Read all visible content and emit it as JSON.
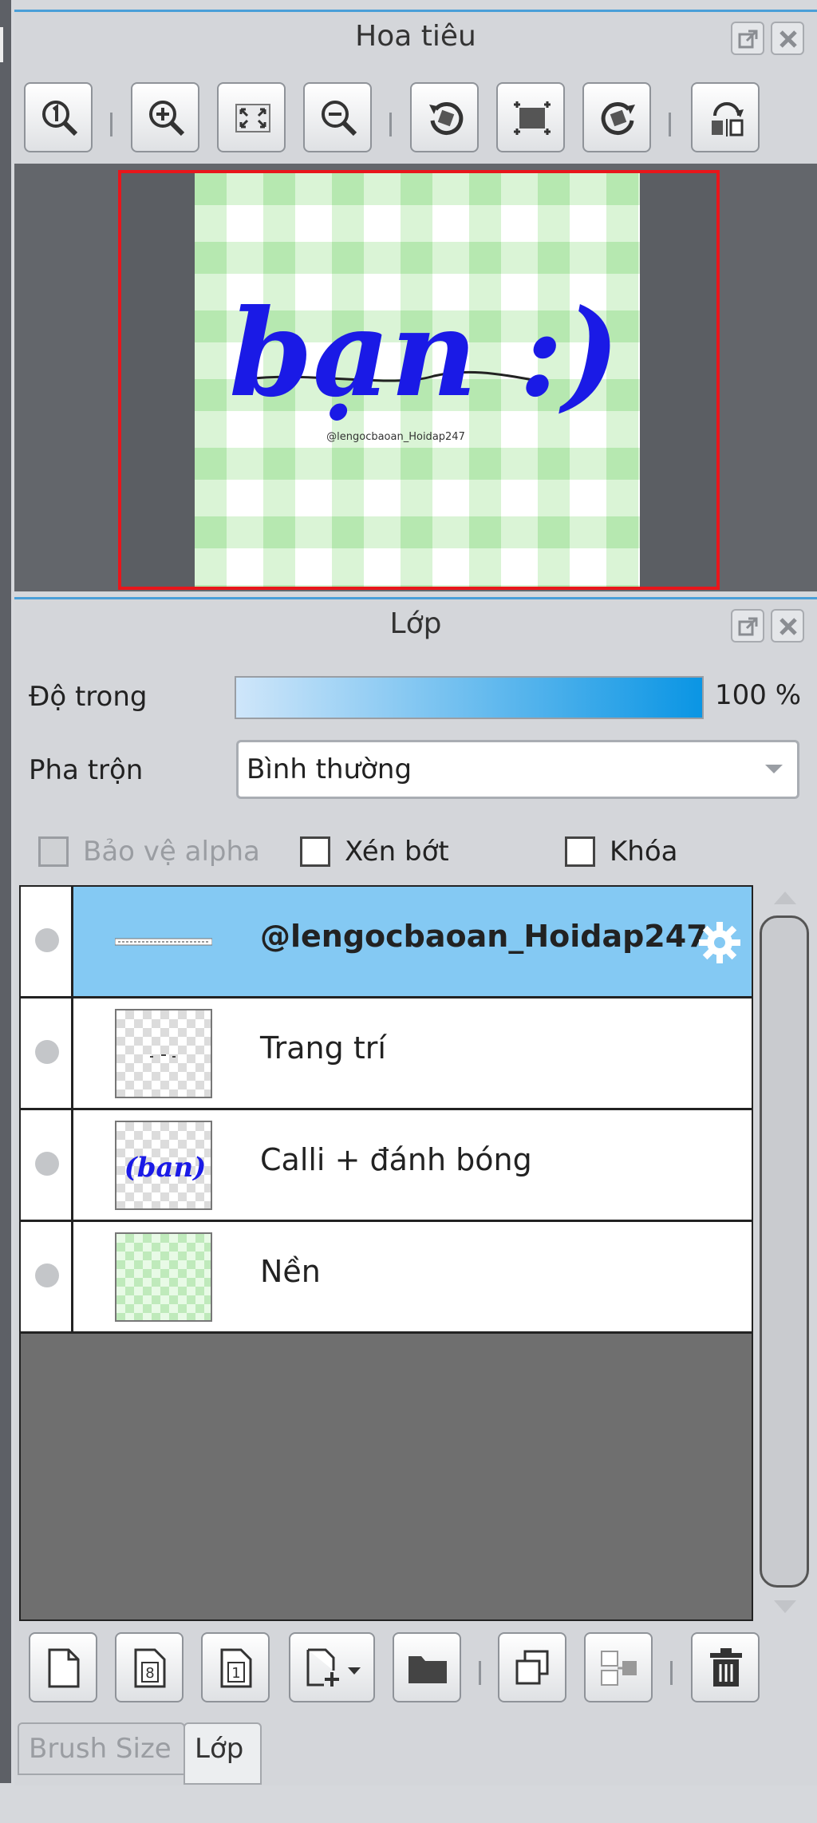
{
  "navigator": {
    "title": "Hoa tiêu",
    "icons": [
      "popout-icon",
      "close-icon"
    ],
    "toolbar": [
      "zoom-actual-icon",
      "zoom-in-icon",
      "fit-screen-icon",
      "zoom-out-icon",
      "rotate-left-icon",
      "reset-rotation-icon",
      "rotate-right-icon",
      "flip-icon"
    ],
    "preview": {
      "art_text": "bạn :)",
      "signature": "@lengocbaoan_Hoidap247",
      "frame_color": "#e8161b",
      "ink_color": "#1a1ae6"
    }
  },
  "layer_panel": {
    "title": "Lớp",
    "opacity_label": "Độ trong",
    "opacity_value": "100 %",
    "opacity_fraction": 1.0,
    "blend_label": "Pha trộn",
    "blend_value": "Bình thường",
    "checkboxes": {
      "alpha_lock": "Bảo vệ alpha",
      "clip": "Xén bớt",
      "lock": "Khóa"
    },
    "layers": [
      {
        "name": "@lengocbaoan_Hoidap247",
        "selected": true
      },
      {
        "name": "Trang trí",
        "selected": false
      },
      {
        "name": "Calli + đánh bóng",
        "selected": false
      },
      {
        "name": "Nền",
        "selected": false
      }
    ],
    "tools": [
      "new-layer-icon",
      "new-8bit-layer-icon",
      "new-1bit-layer-icon",
      "add-layer-menu-icon",
      "new-folder-icon",
      "duplicate-layer-icon",
      "merge-down-icon",
      "delete-layer-icon"
    ]
  },
  "tabs": [
    "Brush Size",
    "Lớp"
  ],
  "colors": {
    "accent": "#4a9fd8",
    "selected_row": "#84c9f3"
  }
}
